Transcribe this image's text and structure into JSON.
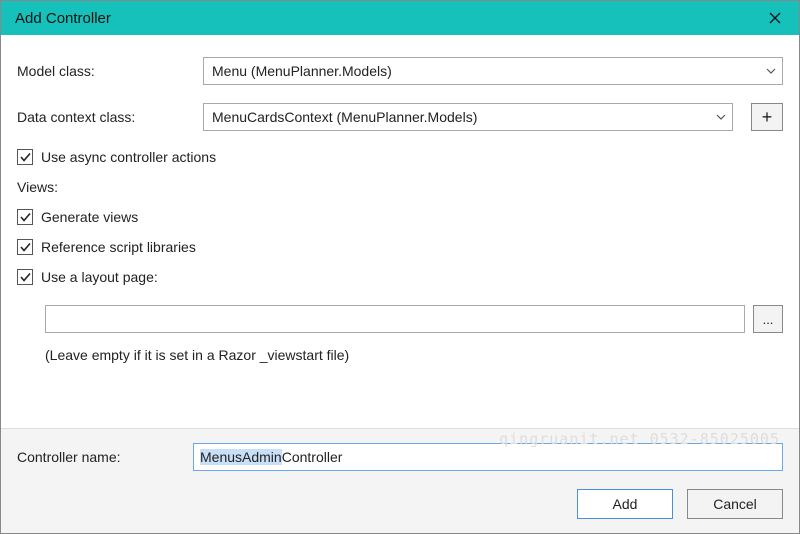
{
  "titlebar": {
    "title": "Add Controller"
  },
  "model_class": {
    "label": "Model class:",
    "value": "Menu (MenuPlanner.Models)"
  },
  "data_context": {
    "label": "Data context class:",
    "value": "MenuCardsContext (MenuPlanner.Models)"
  },
  "async_check": {
    "label": "Use async controller actions",
    "checked": true
  },
  "views_section": {
    "label": "Views:"
  },
  "generate_views": {
    "label": "Generate views",
    "checked": true
  },
  "ref_script": {
    "label": "Reference script libraries",
    "checked": true
  },
  "layout_page": {
    "label": "Use a layout page:",
    "checked": true,
    "value": ""
  },
  "layout_hint": "(Leave empty if it is set in a Razor _viewstart file)",
  "controller_name": {
    "label": "Controller name:",
    "selected": "MenusAdmin",
    "rest": "Controller"
  },
  "buttons": {
    "add": "Add",
    "cancel": "Cancel"
  },
  "plus": "+",
  "browse": "...",
  "watermark": "qingruanit.net 0532-85025005"
}
